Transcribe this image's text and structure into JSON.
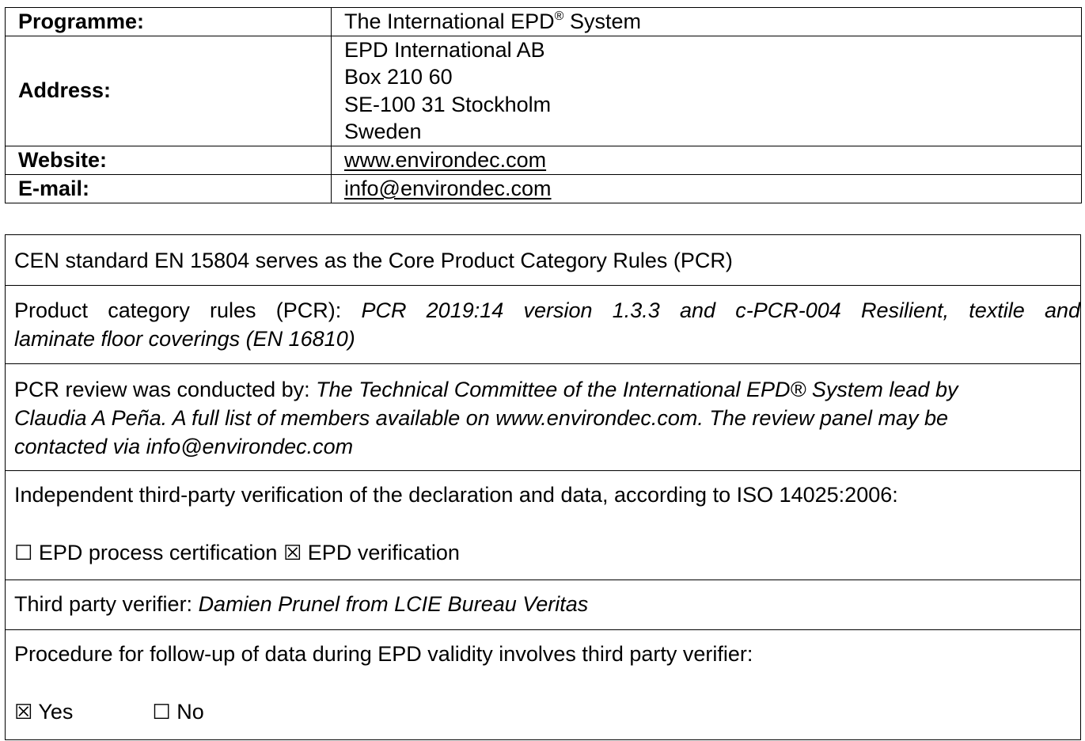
{
  "programme_table": {
    "programme_label": "Programme:",
    "programme_value_text": "The International EPD",
    "programme_value_reg": "®",
    "programme_value_suffix": " System",
    "address_label": "Address:",
    "address_lines": [
      "EPD International AB",
      "Box 210 60",
      "SE-100 31 Stockholm",
      "Sweden"
    ],
    "website_label": "Website:",
    "website_value": "www.environdec.com",
    "email_label": "E-mail:",
    "email_value": "info@environdec.com"
  },
  "verification": {
    "core_pcr": "CEN standard EN 15804 serves as the Core Product Category Rules (PCR)",
    "pcr_label": "Product category rules (PCR): ",
    "pcr_value_line1": "PCR 2019:14 version 1.3.3 and c-PCR-004 Resilient, textile and",
    "pcr_value_line2": "laminate floor coverings (EN 16810)",
    "review_label": "PCR review was conducted by: ",
    "review_value_line1": "The Technical Committee of the International EPD® System lead by",
    "review_value_line2": "Claudia A Peña. A full list of members available on www.environdec.com. The review panel may be",
    "review_value_line3": "contacted via info@environdec.com",
    "independent_text": "Independent third-party verification of the declaration and data, according to ISO 14025:2006:",
    "process_cert_checkbox": "☐",
    "process_cert_label": "EPD process certification",
    "epd_verification_checkbox": "☒",
    "epd_verification_label": "EPD verification",
    "verifier_label": "Third party verifier: ",
    "verifier_value": "Damien Prunel from LCIE Bureau Veritas",
    "followup_text": "Procedure for follow-up of data during EPD validity involves third party verifier:",
    "yes_checkbox": "☒",
    "yes_label": "Yes",
    "no_checkbox": "☐",
    "no_label": "No"
  }
}
